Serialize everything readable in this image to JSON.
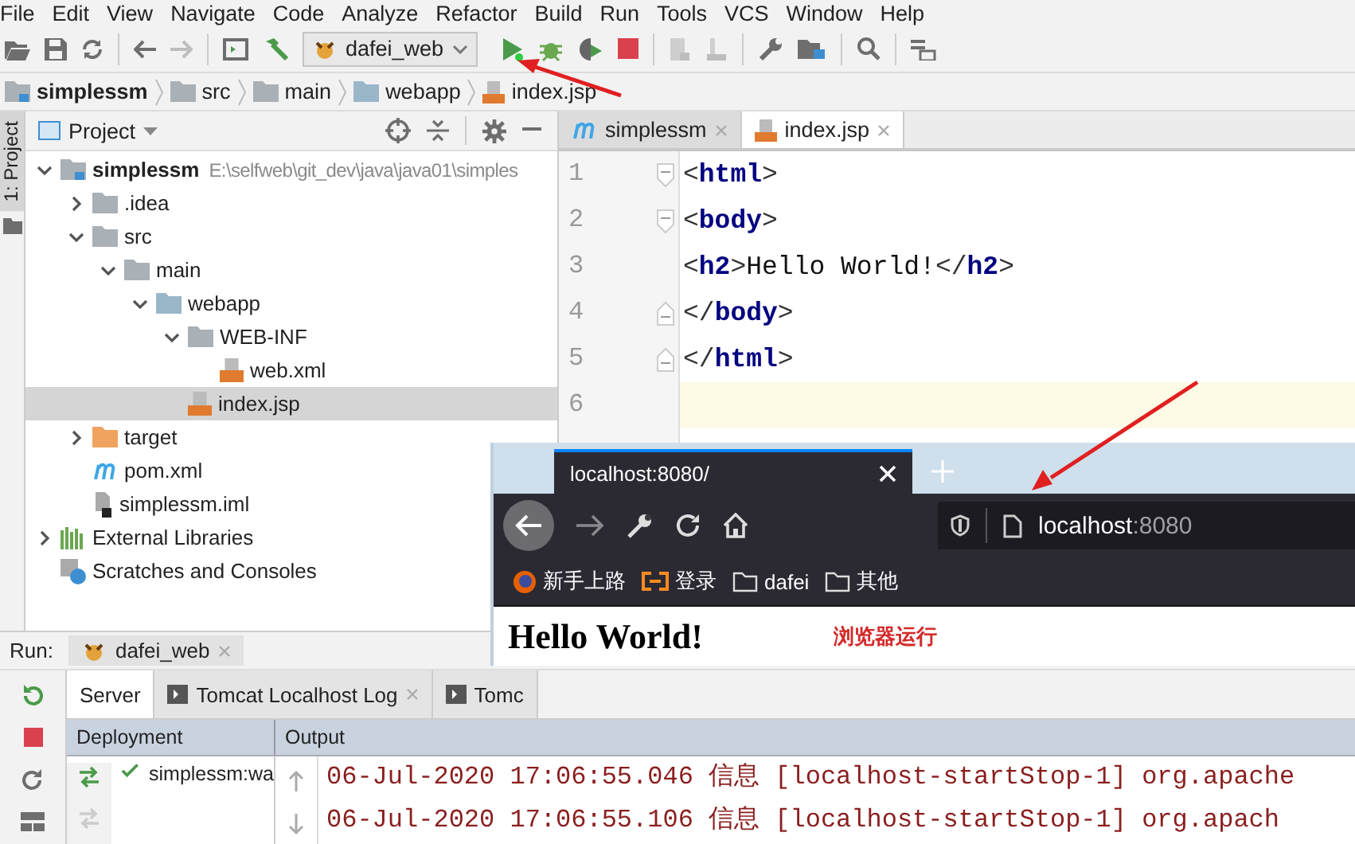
{
  "menu": [
    "File",
    "Edit",
    "View",
    "Navigate",
    "Code",
    "Analyze",
    "Refactor",
    "Build",
    "Run",
    "Tools",
    "VCS",
    "Window",
    "Help"
  ],
  "toolbar": {
    "run_config": "dafei_web"
  },
  "breadcrumb": [
    {
      "label": "simplessm",
      "kind": "module"
    },
    {
      "label": "src",
      "kind": "folder"
    },
    {
      "label": "main",
      "kind": "folder"
    },
    {
      "label": "webapp",
      "kind": "webfolder"
    },
    {
      "label": "index.jsp",
      "kind": "jsp"
    }
  ],
  "side_tab": "1: Project",
  "project_panel": {
    "title": "Project",
    "tree": [
      {
        "name": "simplessm",
        "path": "E:\\selfweb\\git_dev\\java\\java01\\simples",
        "kind": "module",
        "expanded": true,
        "selected": false,
        "children": [
          {
            "name": ".idea",
            "kind": "folder",
            "expanded": false,
            "selected": false
          },
          {
            "name": "src",
            "kind": "folder",
            "expanded": true,
            "selected": false,
            "children": [
              {
                "name": "main",
                "kind": "folder",
                "expanded": true,
                "selected": false,
                "children": [
                  {
                    "name": "webapp",
                    "kind": "webfolder",
                    "expanded": true,
                    "selected": false,
                    "children": [
                      {
                        "name": "WEB-INF",
                        "kind": "folder",
                        "expanded": true,
                        "selected": false,
                        "children": [
                          {
                            "name": "web.xml",
                            "kind": "xml",
                            "selected": false
                          }
                        ]
                      },
                      {
                        "name": "index.jsp",
                        "kind": "jsp",
                        "selected": true
                      }
                    ]
                  }
                ]
              }
            ]
          },
          {
            "name": "target",
            "kind": "excluded",
            "expanded": false,
            "selected": false
          },
          {
            "name": "pom.xml",
            "kind": "maven",
            "selected": false
          },
          {
            "name": "simplessm.iml",
            "kind": "iml",
            "selected": false
          }
        ]
      },
      {
        "name": "External Libraries",
        "kind": "libs",
        "expanded": false,
        "selected": false
      },
      {
        "name": "Scratches and Consoles",
        "kind": "scratch",
        "selected": false
      }
    ]
  },
  "editor": {
    "tabs": [
      {
        "label": "simplessm",
        "kind": "maven",
        "selected": false
      },
      {
        "label": "index.jsp",
        "kind": "jsp",
        "selected": true
      }
    ],
    "lines": [
      {
        "number": "1",
        "kind": "open",
        "current": false,
        "tokens": [
          {
            "kind": "punct",
            "text": "<"
          },
          {
            "kind": "tag",
            "text": "html"
          },
          {
            "kind": "punct",
            "text": ">"
          }
        ]
      },
      {
        "number": "2",
        "kind": "open",
        "current": false,
        "tokens": [
          {
            "kind": "punct",
            "text": "<"
          },
          {
            "kind": "tag",
            "text": "body"
          },
          {
            "kind": "punct",
            "text": ">"
          }
        ]
      },
      {
        "number": "3",
        "kind": "plain",
        "current": false,
        "tokens": [
          {
            "kind": "punct",
            "text": "<"
          },
          {
            "kind": "tag",
            "text": "h2"
          },
          {
            "kind": "punct",
            "text": ">"
          },
          {
            "kind": "text",
            "text": "Hello World!"
          },
          {
            "kind": "punct",
            "text": "</"
          },
          {
            "kind": "tag",
            "text": "h2"
          },
          {
            "kind": "punct",
            "text": ">"
          }
        ]
      },
      {
        "number": "4",
        "kind": "close",
        "current": false,
        "tokens": [
          {
            "kind": "punct",
            "text": "</"
          },
          {
            "kind": "tag",
            "text": "body"
          },
          {
            "kind": "punct",
            "text": ">"
          }
        ]
      },
      {
        "number": "5",
        "kind": "close",
        "current": false,
        "tokens": [
          {
            "kind": "punct",
            "text": "</"
          },
          {
            "kind": "tag",
            "text": "html"
          },
          {
            "kind": "punct",
            "text": ">"
          }
        ]
      },
      {
        "number": "6",
        "kind": "plain",
        "current": true
      }
    ]
  },
  "browser": {
    "tab_title": "localhost:8080/",
    "url_host": "localhost",
    "url_port": ":8080",
    "bookmarks": [
      {
        "label": "新手上路",
        "kind": "firefox"
      },
      {
        "label": "登录",
        "kind": "login"
      },
      {
        "label": "dafei",
        "kind": "folder"
      },
      {
        "label": "其他",
        "kind": "folder"
      }
    ],
    "heading": "Hello World!",
    "note": "浏览器运行"
  },
  "run_panel": {
    "label": "Run:",
    "config_tab": "dafei_web",
    "tabs": [
      {
        "label": "Server",
        "kind": "plain",
        "selected": true
      },
      {
        "label": "Tomcat Localhost Log",
        "kind": "log",
        "selected": false
      },
      {
        "label": "Tomc",
        "kind": "log",
        "selected": false
      }
    ],
    "columns": [
      "Deployment",
      "Output"
    ],
    "deployment": "simplessm:wa",
    "output": [
      "06-Jul-2020 17:06:55.046 信息 [localhost-startStop-1] org.apache",
      "06-Jul-2020 17:06:55.106 信息 [localhost-startStop-1] org.apach"
    ]
  }
}
